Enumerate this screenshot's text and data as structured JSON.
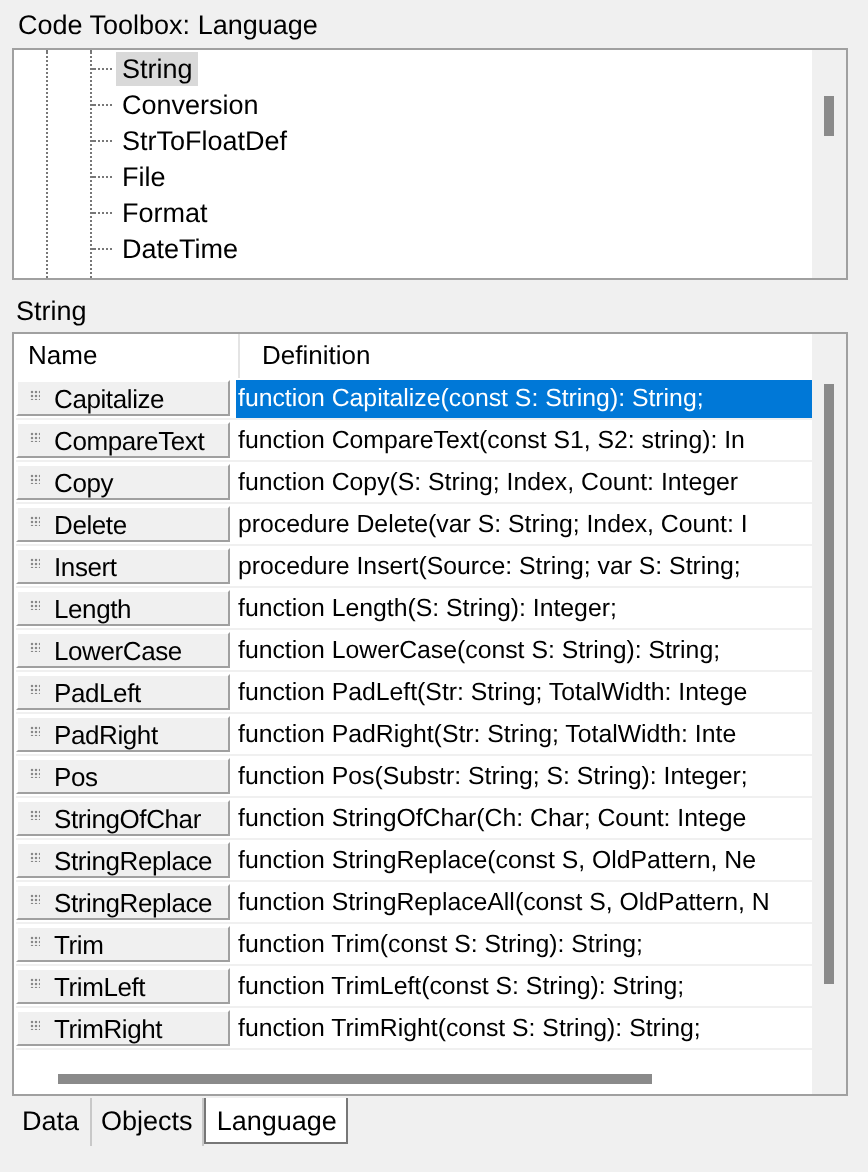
{
  "title": "Code Toolbox: Language",
  "tree": {
    "items": [
      {
        "label": "String",
        "selected": true
      },
      {
        "label": "Conversion",
        "selected": false
      },
      {
        "label": "StrToFloatDef",
        "selected": false
      },
      {
        "label": "File",
        "selected": false
      },
      {
        "label": "Format",
        "selected": false
      },
      {
        "label": "DateTime",
        "selected": false
      }
    ]
  },
  "section_label": "String",
  "table": {
    "columns": [
      "Name",
      "Definition"
    ],
    "rows": [
      {
        "name": "Capitalize",
        "definition": "function Capitalize(const S: String): String;",
        "selected": true
      },
      {
        "name": "CompareText",
        "definition": "function CompareText(const S1, S2: string): In",
        "selected": false
      },
      {
        "name": "Copy",
        "definition": "function Copy(S: String; Index, Count: Integer",
        "selected": false
      },
      {
        "name": "Delete",
        "definition": "procedure Delete(var S: String; Index, Count: I",
        "selected": false
      },
      {
        "name": "Insert",
        "definition": "procedure Insert(Source: String; var S: String;",
        "selected": false
      },
      {
        "name": "Length",
        "definition": "function Length(S: String): Integer;",
        "selected": false
      },
      {
        "name": "LowerCase",
        "definition": "function LowerCase(const S: String): String;",
        "selected": false
      },
      {
        "name": "PadLeft",
        "definition": "function PadLeft(Str: String; TotalWidth: Intege",
        "selected": false
      },
      {
        "name": "PadRight",
        "definition": "function PadRight(Str: String; TotalWidth: Inte",
        "selected": false
      },
      {
        "name": "Pos",
        "definition": "function Pos(Substr: String; S: String): Integer;",
        "selected": false
      },
      {
        "name": "StringOfChar",
        "definition": "function StringOfChar(Ch: Char; Count: Intege",
        "selected": false
      },
      {
        "name": "StringReplace",
        "definition": "function StringReplace(const S, OldPattern, Ne",
        "selected": false
      },
      {
        "name": "StringReplace",
        "definition": "function StringReplaceAll(const S, OldPattern, N",
        "selected": false
      },
      {
        "name": "Trim",
        "definition": "function Trim(const S: String): String;",
        "selected": false
      },
      {
        "name": "TrimLeft",
        "definition": "function TrimLeft(const S: String): String;",
        "selected": false
      },
      {
        "name": "TrimRight",
        "definition": "function TrimRight(const S: String): String;",
        "selected": false
      }
    ]
  },
  "tabs": [
    {
      "label": "Data",
      "selected": false
    },
    {
      "label": "Objects",
      "selected": false
    },
    {
      "label": "Language",
      "selected": true
    }
  ]
}
